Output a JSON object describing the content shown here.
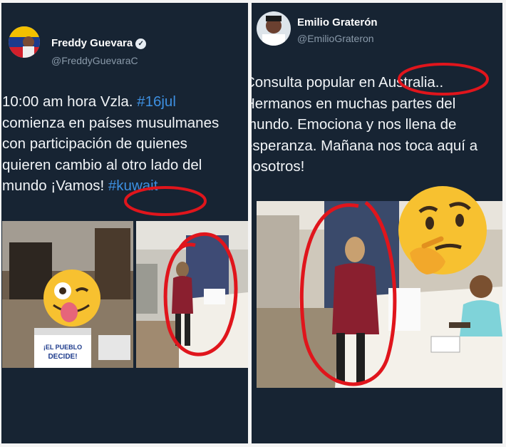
{
  "left_tweet": {
    "name": "Freddy Guevara",
    "handle": "@FreddyGuevaraC",
    "verified_icon": "verified-check-icon",
    "text_line1_prefix": "10:00 am hora Vzla. ",
    "text_line1_hashtag": "#16jul",
    "text_line2": "comienza en países musulmanes",
    "text_line3": "con participación de quienes",
    "text_line4": "quieren cambio al otro lado del",
    "text_line5_prefix": "mundo ¡Vamos! ",
    "text_line5_hashtag": "#kuwait",
    "ballot_box_text_1": "¡EL PUEBLO",
    "ballot_box_text_2": "DECIDE!"
  },
  "right_tweet": {
    "name": "Emilio Graterón",
    "handle": "@EmilioGrateron",
    "text_line1": "Consulta popular en Australia..",
    "text_line2": "Hermanos en muchas partes del",
    "text_line3": "mundo. Emociona y nos llena de",
    "text_line4": "esperanza. Mañana nos toca aquí a",
    "text_line5": "nosotros!"
  },
  "overlays": {
    "emoji_left": "winking-tongue-emoji",
    "emoji_right": "thinking-face-emoji",
    "highlight_color": "#e0151c"
  },
  "colors": {
    "panel_bg": "#172433",
    "text": "#f1f4f7",
    "link": "#3d8fe0",
    "muted": "#8a9aaa"
  }
}
